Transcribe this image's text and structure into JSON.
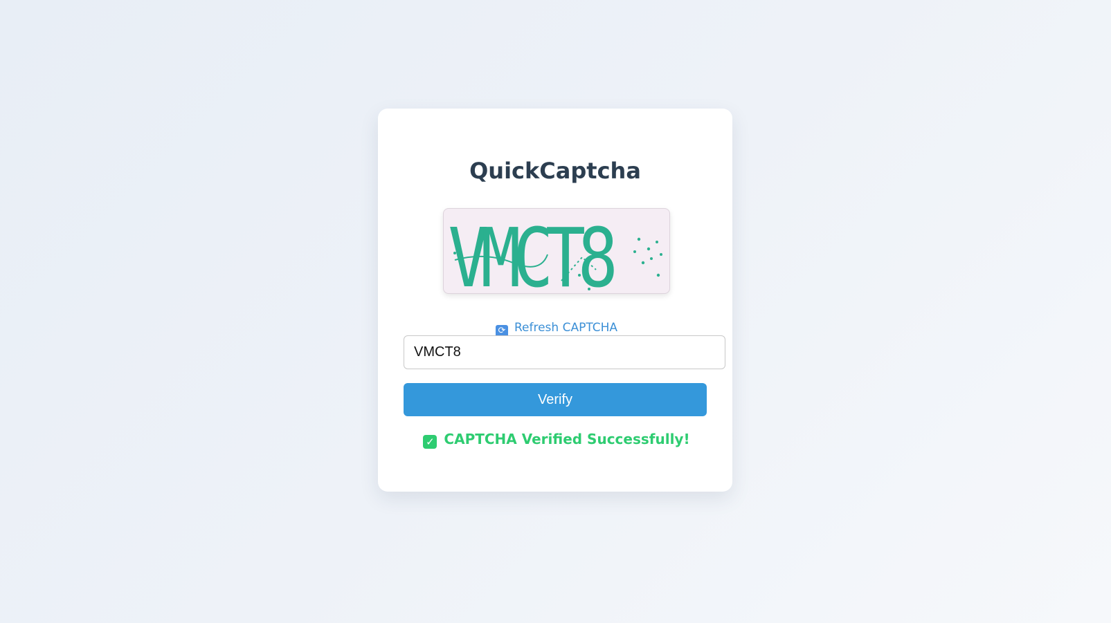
{
  "app": {
    "title": "QuickCaptcha"
  },
  "captcha": {
    "image_text": "VMCT8",
    "text_color": "#2bb08f",
    "background_color": "#f5edf4"
  },
  "refresh": {
    "icon": "refresh-icon",
    "label": "Refresh CAPTCHA"
  },
  "input": {
    "value": "VMCT8"
  },
  "verify": {
    "label": "Verify",
    "color": "#3498db"
  },
  "status": {
    "icon": "check-icon",
    "message": "CAPTCHA Verified Successfully!",
    "color": "#2ecc71"
  }
}
